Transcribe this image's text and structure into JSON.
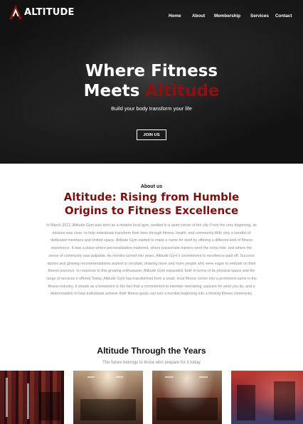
{
  "brand": {
    "name": "ALTITUDE",
    "accent_color": "#8b1212"
  },
  "nav": {
    "items": [
      {
        "label": "Home"
      },
      {
        "label": "About"
      },
      {
        "label": "Membership"
      },
      {
        "label": "Services"
      },
      {
        "label": "Contact"
      }
    ]
  },
  "hero": {
    "title_line1": "Where Fitness",
    "title_line2_prefix": "Meets ",
    "title_line2_accent": "Altitude",
    "subtitle": "Build your body transform your life",
    "cta_label": "JOIN US"
  },
  "about": {
    "label": "About us",
    "title_line1": "Altitude: Rising from Humble",
    "title_line2": "Origins to Fitness Excellence",
    "body": "In March 2012, Altitude Gym was born as a modest local gym, nestled in a quiet corner of the city. From the very beginning, its mission was clear: to help individuals transform their lives through fitness, health, and community.With only a handful of dedicated members and limited space, Altitude Gym started to make a name for itself by offering a different kind of fitness experience. It was a place where personalization mattered, where passionate trainers went the extra mile, and where the sense of community was palpable. As months turned into years, Altitude Gym's commitment to excellence paid off. Success stories and glowing recommendations started to circulate, drawing more and more people who were eager to embark on their fitness journeys. In response to this growing enthusiasm, Altitude Gym expanded, both in terms of its physical space and the range of services it offered.Today, Altitude Gym has transformed from a small, local fitness center into a prominent name in the fitness industry. It stands as a testament to the fact that a commitment to member well-being, passion for what you do, and a determination to help individuals achieve their fitness goals can turn a humble beginning into a thriving fitness community."
  },
  "years": {
    "title": "Altitude Through the Years",
    "subtitle": "The future belongs to those who prepare for it today"
  },
  "gallery": {
    "photos": [
      {
        "icon": "gym-photo"
      },
      {
        "icon": "gym-photo"
      },
      {
        "icon": "gym-photo"
      },
      {
        "icon": "gym-photo"
      }
    ]
  }
}
